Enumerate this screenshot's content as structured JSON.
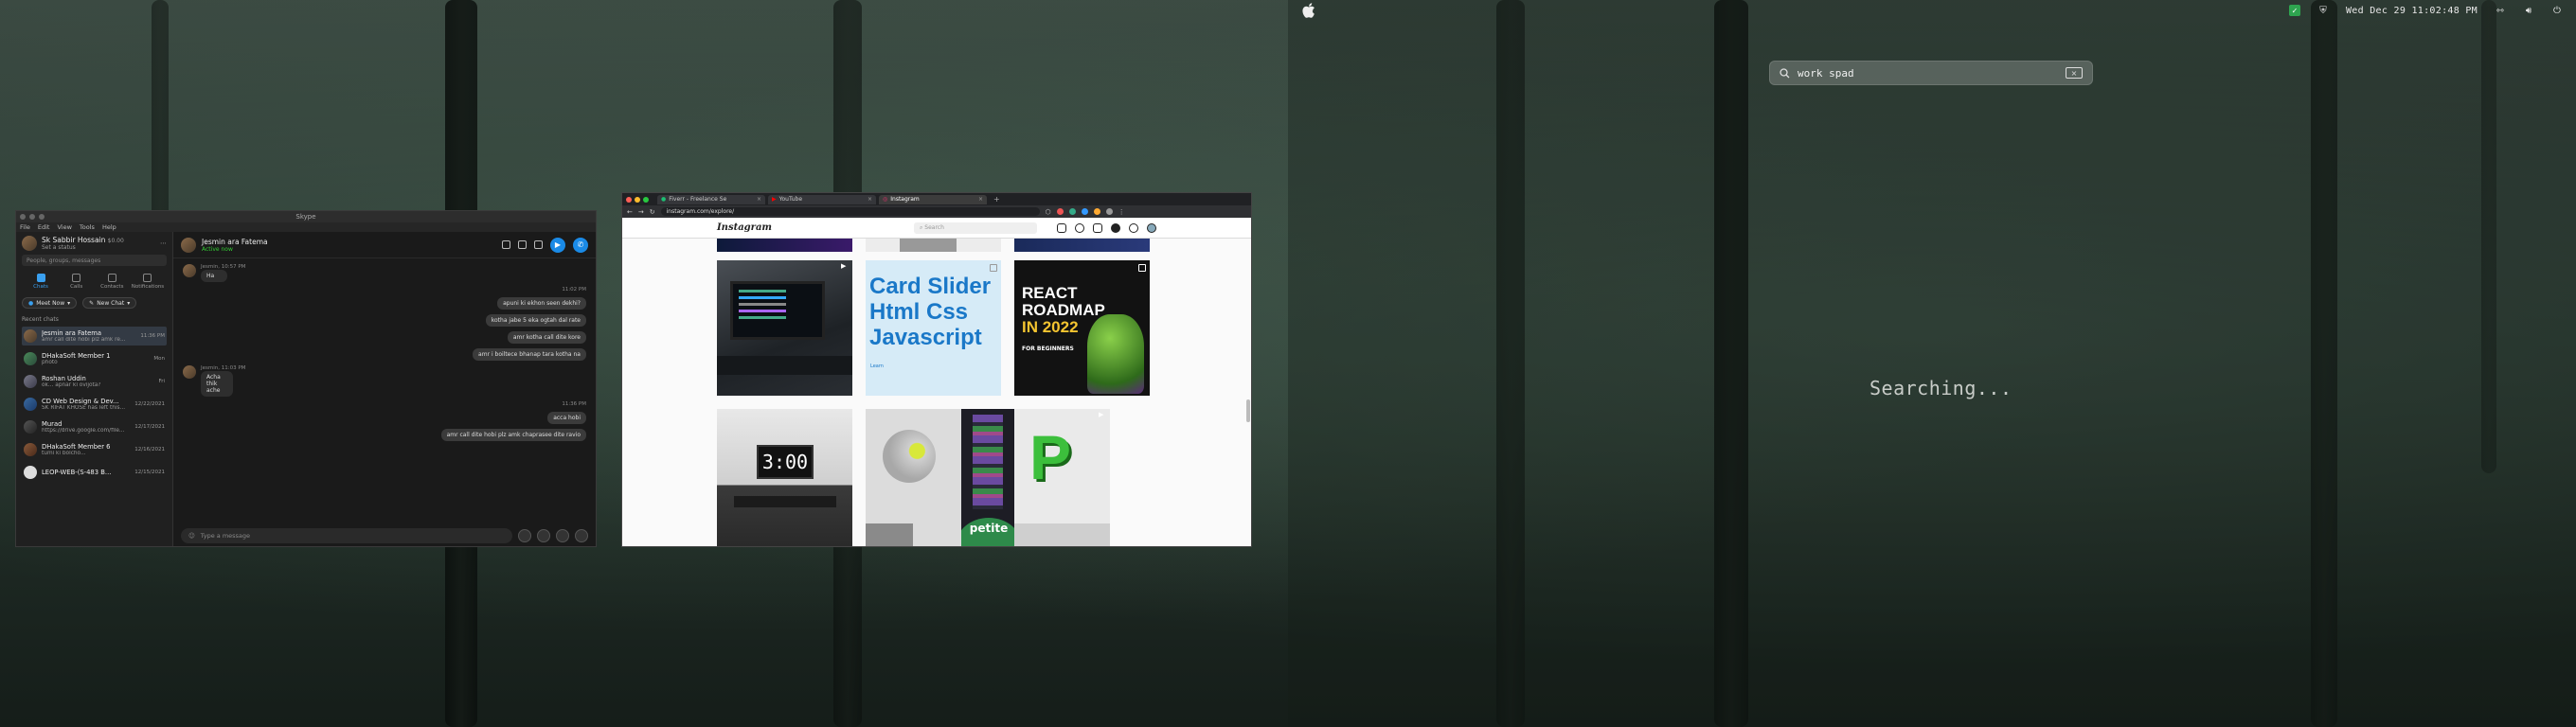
{
  "menubar": {
    "clock": "Wed Dec 29 11:02:48 PM",
    "icons": [
      "apple-icon",
      "green-check-icon",
      "shield-icon",
      "network-icon",
      "volume-icon",
      "power-icon"
    ]
  },
  "spotlight": {
    "query": "work spad",
    "status": "Searching..."
  },
  "skype": {
    "window_title": "Skype",
    "menu": [
      "File",
      "Edit",
      "View",
      "Tools",
      "Help"
    ],
    "profile": {
      "name": "Sk Sabbir Hossain",
      "sub": "Set a status",
      "balance": "$0.00"
    },
    "search_placeholder": "People, groups, messages",
    "nav": [
      "Chats",
      "Calls",
      "Contacts",
      "Notifications"
    ],
    "meet_now": "Meet Now",
    "new_chat": "New Chat",
    "section": "Recent chats",
    "chats": [
      {
        "name": "Jesmin ara Fatema",
        "preview": "amr call dite hobi plz amk re...",
        "time": "11:36 PM"
      },
      {
        "name": "DHakaSoft Member 1",
        "preview": "photo",
        "time": "Mon"
      },
      {
        "name": "Roshan Uddin",
        "preview": "ok... apnar ki ovijota?",
        "time": "Fri"
      },
      {
        "name": "CD Web Design & Dev...",
        "preview": "SK RIFAT KHOSE has left this...",
        "time": "12/22/2021"
      },
      {
        "name": "Murad",
        "preview": "https://drive.google.com/file...",
        "time": "12/17/2021"
      },
      {
        "name": "DHakaSoft Member 6",
        "preview": "tumi ki bolcho...",
        "time": "12/16/2021"
      },
      {
        "name": "LEOP-WEB-(S-483 B...",
        "preview": "",
        "time": "12/15/2021"
      }
    ],
    "header": {
      "name": "Jesmin ara Fatema",
      "status": "Active now"
    },
    "messages": [
      {
        "dir": "in",
        "meta": "Jesmin, 10:57 PM",
        "text": "Ha"
      },
      {
        "dir": "time",
        "text": "11:02 PM"
      },
      {
        "dir": "out",
        "text": "apuni ki ekhon seen dekhi?"
      },
      {
        "dir": "out",
        "text": "kotha jabe 5 eka ogtah dal rate"
      },
      {
        "dir": "out",
        "text": "amr kotha call dite kore"
      },
      {
        "dir": "out",
        "text": "amr i boiltece bhanap tara kotha na"
      },
      {
        "dir": "in",
        "meta": "Jesmin, 11:03 PM",
        "text": "Acha thik ache"
      },
      {
        "dir": "time",
        "text": "11:36 PM"
      },
      {
        "dir": "out",
        "text": "acca hobi"
      },
      {
        "dir": "out",
        "text": "amr call dite hobi plz amk chaprasee dite ravio"
      }
    ],
    "compose_placeholder": "Type a message"
  },
  "browser": {
    "tabs": [
      {
        "label": "Fiverr - Freelance Se",
        "active": false
      },
      {
        "label": "YouTube",
        "active": false
      },
      {
        "label": "Instagram",
        "active": true
      }
    ],
    "url": "instagram.com/explore/",
    "ig_logo": "Instagram",
    "ig_search": "Search",
    "tiles": {
      "card_slider": [
        "Card Slider",
        "Html Css",
        "Javascript"
      ],
      "card_slider_foot": "Learn",
      "react_roadmap": [
        "REACT",
        "ROADMAP"
      ],
      "react_year": "IN 2022",
      "react_foot": "FOR BEGINNERS",
      "clock_tile": "3:00",
      "p_letter": "P",
      "petite": "petite"
    }
  }
}
